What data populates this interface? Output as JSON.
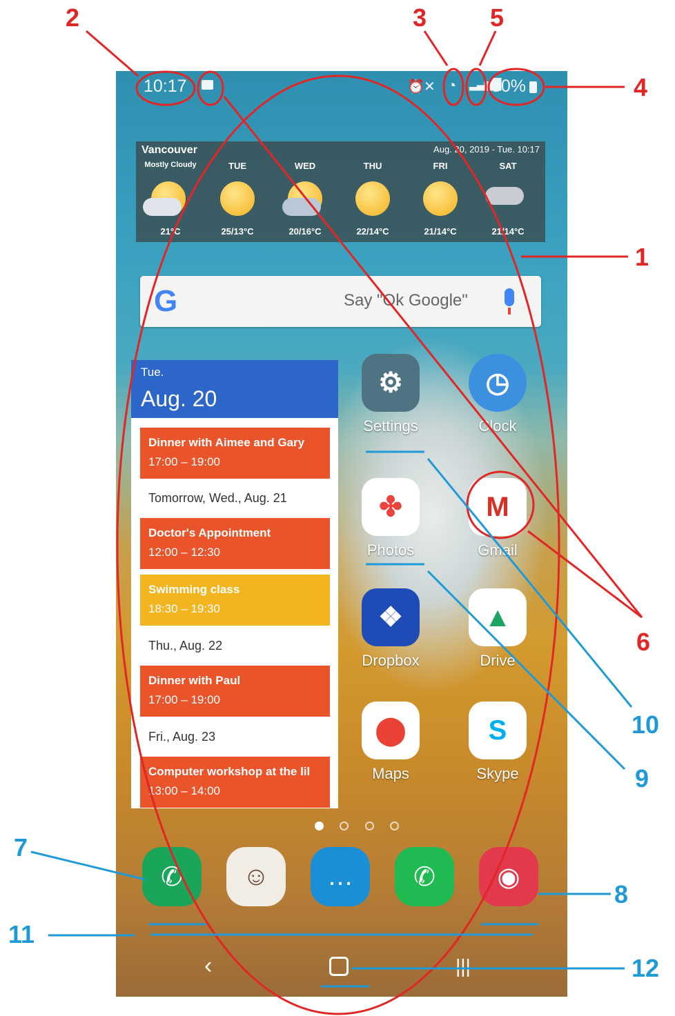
{
  "status_bar": {
    "time": "10:17",
    "battery": "80%"
  },
  "weather": {
    "city": "Vancouver",
    "datetime": "Aug. 20, 2019 - Tue. 10:17",
    "days": [
      {
        "label": "Mostly Cloudy",
        "temp": "21°C"
      },
      {
        "label": "TUE",
        "temp": "25/13°C"
      },
      {
        "label": "WED",
        "temp": "20/16°C"
      },
      {
        "label": "THU",
        "temp": "22/14°C"
      },
      {
        "label": "FRI",
        "temp": "21/14°C"
      },
      {
        "label": "SAT",
        "temp": "21/14°C"
      }
    ]
  },
  "search": {
    "logo": "G",
    "placeholder": "Say \"Ok Google\""
  },
  "calendar": {
    "dow": "Tue.",
    "date": "Aug. 20",
    "events": [
      {
        "title": "Dinner with Aimee and Gary",
        "time": "17:00 – 19:00",
        "color": "#e9542a"
      },
      {
        "title": "Doctor's Appointment",
        "time": "12:00 – 12:30",
        "color": "#e9542a"
      },
      {
        "title": "Swimming class",
        "time": "18:30 – 19:30",
        "color": "#f2b41f"
      },
      {
        "title": "Dinner with Paul",
        "time": "17:00 – 19:00",
        "color": "#e9542a"
      },
      {
        "title": "Computer workshop at the lil",
        "time": "13:00 – 14:00",
        "color": "#e9542a"
      }
    ],
    "day_headers": [
      "Tomorrow, Wed., Aug. 21",
      "Thu., Aug. 22",
      "Fri., Aug. 23"
    ]
  },
  "apps": [
    {
      "label": "Settings",
      "icon": "gear-icon",
      "color": "#4f7383"
    },
    {
      "label": "Clock",
      "icon": "clock-icon",
      "color": "#3d8fe0"
    },
    {
      "label": "Photos",
      "icon": "pinwheel-icon",
      "color": "#ffffff"
    },
    {
      "label": "Gmail",
      "icon": "envelope-icon",
      "color": "#ffffff"
    },
    {
      "label": "Dropbox",
      "icon": "dropbox-icon",
      "color": "#1e4bb5"
    },
    {
      "label": "Drive",
      "icon": "drive-icon",
      "color": "#ffffff"
    },
    {
      "label": "Maps",
      "icon": "map-pin-icon",
      "color": "#ffffff"
    },
    {
      "label": "Skype",
      "icon": "skype-icon",
      "color": "#ffffff"
    }
  ],
  "dock": [
    {
      "name": "phone",
      "icon": "phone-icon",
      "color": "#1aa55b"
    },
    {
      "name": "contacts",
      "icon": "contacts-icon",
      "color": "#f1ece4"
    },
    {
      "name": "messages",
      "icon": "chat-bubble-icon",
      "color": "#1b8fd6"
    },
    {
      "name": "whatsapp",
      "icon": "whatsapp-icon",
      "color": "#1fba52"
    },
    {
      "name": "camera",
      "icon": "camera-icon",
      "color": "#e23a4c"
    }
  ],
  "annotations": {
    "n1": "1",
    "n2": "2",
    "n3": "3",
    "n4": "4",
    "n5": "5",
    "n6": "6",
    "n7": "7",
    "n8": "8",
    "n9": "9",
    "n10": "10",
    "n11": "11",
    "n12": "12"
  }
}
